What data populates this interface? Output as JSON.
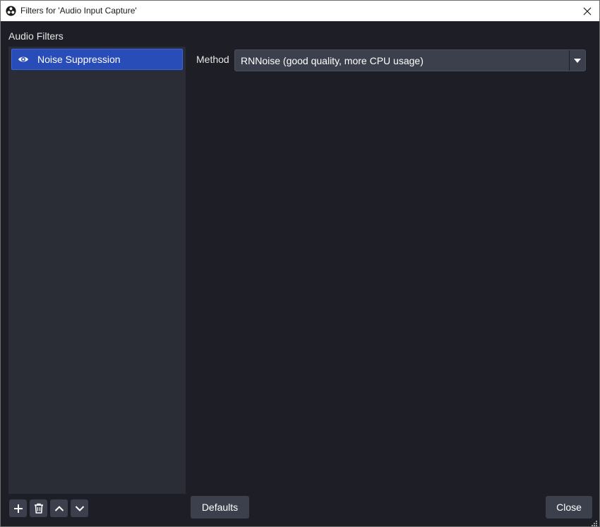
{
  "window": {
    "title": "Filters for 'Audio Input Capture'"
  },
  "filters": {
    "heading": "Audio Filters",
    "items": [
      {
        "label": "Noise Suppression",
        "visible": true,
        "selected": true
      }
    ]
  },
  "toolbar": {
    "add_icon": "plus-icon",
    "remove_icon": "trash-icon",
    "move_up_icon": "chevron-up-icon",
    "move_down_icon": "chevron-down-icon"
  },
  "properties": {
    "method_label": "Method",
    "method_value": "RNNoise (good quality, more CPU usage)"
  },
  "buttons": {
    "defaults": "Defaults",
    "close": "Close"
  },
  "colors": {
    "background": "#1e1f26",
    "panel": "#2a2c36",
    "selection": "#284cb8",
    "button": "#3c404d",
    "text": "#ffffff"
  }
}
